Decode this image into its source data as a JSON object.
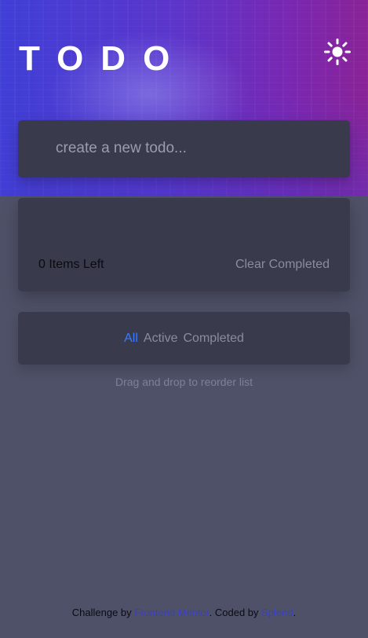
{
  "header": {
    "logo": "TODO",
    "theme_toggle_icon": "sun-icon"
  },
  "new_todo": {
    "placeholder": "create a new todo...",
    "value": ""
  },
  "todo_list": {
    "items": [],
    "items_left_text": "0 Items Left",
    "clear_completed_label": "Clear Completed"
  },
  "filters": {
    "items": [
      {
        "label": "All",
        "active": true
      },
      {
        "label": "Active",
        "active": false
      },
      {
        "label": "Completed",
        "active": false
      }
    ],
    "active_color": "#3a7bfd"
  },
  "hint": "Drag and drop to reorder list",
  "attribution": {
    "prefix": "Challenge by ",
    "challenge_link": "Frontend Mentor",
    "middle": ". Coded by ",
    "coder_link": "Splend",
    "suffix": "."
  },
  "colors": {
    "background": "#4f5168",
    "panel": "#393a4b",
    "accent": "#3a7bfd",
    "hero_gradient_start": "#3f3fd6",
    "hero_gradient_end": "#8a2397"
  }
}
